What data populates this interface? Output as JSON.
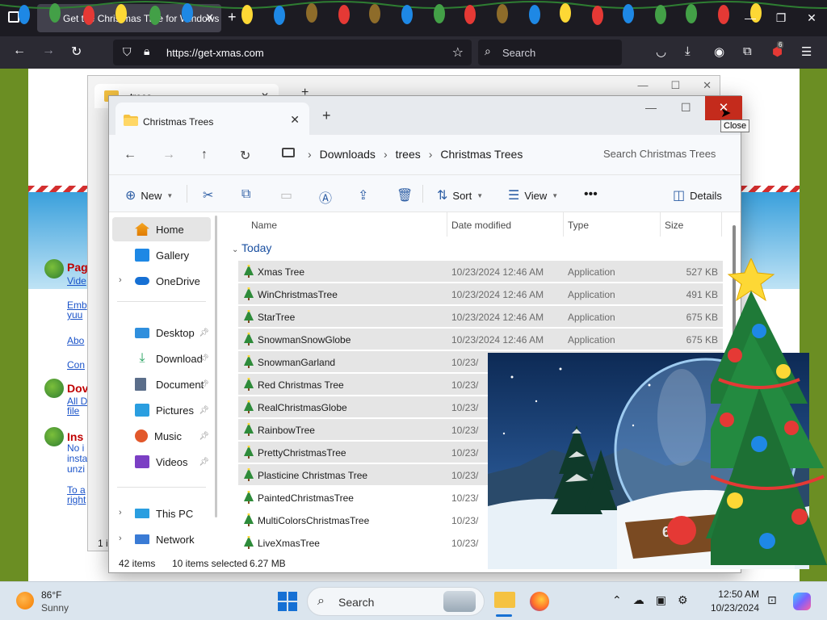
{
  "browser": {
    "tab_title": "Get the Christmas Tree for Windows",
    "url": "https://get-xmas.com",
    "search_placeholder": "Search",
    "extensions_badge": "6"
  },
  "webpage": {
    "sections": [
      {
        "heading": "Pag",
        "link": "Vide"
      },
      {
        "heading": "Dov",
        "link": "All D file"
      },
      {
        "heading": "Ins",
        "text": "No i insta unzi"
      }
    ],
    "links": [
      "Emb yuu",
      "Abo",
      "Con",
      "To a right"
    ]
  },
  "back_window": {
    "tab_title": "trees",
    "status_count": "1 i"
  },
  "explorer": {
    "tab_title": "Christmas Trees",
    "tooltip": "Close",
    "breadcrumb": [
      "Downloads",
      "trees",
      "Christmas Trees"
    ],
    "search_placeholder": "Search Christmas Trees",
    "toolbar": {
      "new": "New",
      "sort": "Sort",
      "view": "View",
      "details": "Details"
    },
    "nav": {
      "home": "Home",
      "gallery": "Gallery",
      "onedrive": "OneDrive",
      "desktop": "Desktop",
      "downloads": "Download",
      "documents": "Document",
      "pictures": "Pictures",
      "music": "Music",
      "videos": "Videos",
      "thispc": "This PC",
      "network": "Network"
    },
    "columns": {
      "name": "Name",
      "date": "Date modified",
      "type": "Type",
      "size": "Size"
    },
    "group": "Today",
    "files": [
      {
        "name": "Xmas Tree",
        "date": "10/23/2024 12:46 AM",
        "type": "Application",
        "size": "527 KB",
        "selected": true
      },
      {
        "name": "WinChristmasTree",
        "date": "10/23/2024 12:46 AM",
        "type": "Application",
        "size": "491 KB",
        "selected": true
      },
      {
        "name": "StarTree",
        "date": "10/23/2024 12:46 AM",
        "type": "Application",
        "size": "675 KB",
        "selected": true
      },
      {
        "name": "SnowmanSnowGlobe",
        "date": "10/23/2024 12:46 AM",
        "type": "Application",
        "size": "675 KB",
        "selected": true
      },
      {
        "name": "SnowmanGarland",
        "date": "10/23/",
        "type": "",
        "size": "",
        "selected": true
      },
      {
        "name": "Red Christmas Tree",
        "date": "10/23/",
        "type": "",
        "size": "",
        "selected": true
      },
      {
        "name": "RealChristmasGlobe",
        "date": "10/23/",
        "type": "",
        "size": "",
        "selected": true
      },
      {
        "name": "RainbowTree",
        "date": "10/23/",
        "type": "",
        "size": "",
        "selected": true
      },
      {
        "name": "PrettyChristmasTree",
        "date": "10/23/",
        "type": "",
        "size": "",
        "selected": true
      },
      {
        "name": "Plasticine Christmas Tree",
        "date": "10/23/",
        "type": "",
        "size": "",
        "selected": true
      },
      {
        "name": "PaintedChristmasTree",
        "date": "10/23/",
        "type": "",
        "size": "",
        "selected": false
      },
      {
        "name": "MultiColorsChristmasTree",
        "date": "10/23/",
        "type": "",
        "size": "",
        "selected": false
      },
      {
        "name": "LiveXmasTree",
        "date": "10/23/",
        "type": "",
        "size": "",
        "selected": false
      }
    ],
    "status": {
      "count": "42 items",
      "selection": "10 items selected",
      "size": "6.27 MB"
    }
  },
  "overlay": {
    "snowglobe_label": "62"
  },
  "taskbar": {
    "temperature": "86°F",
    "condition": "Sunny",
    "search_label": "Search",
    "time": "12:50 AM",
    "date": "10/23/2024"
  },
  "colors": {
    "accent": "#1670d4",
    "close_red": "#c42b1c",
    "folder": "#f5c242"
  }
}
